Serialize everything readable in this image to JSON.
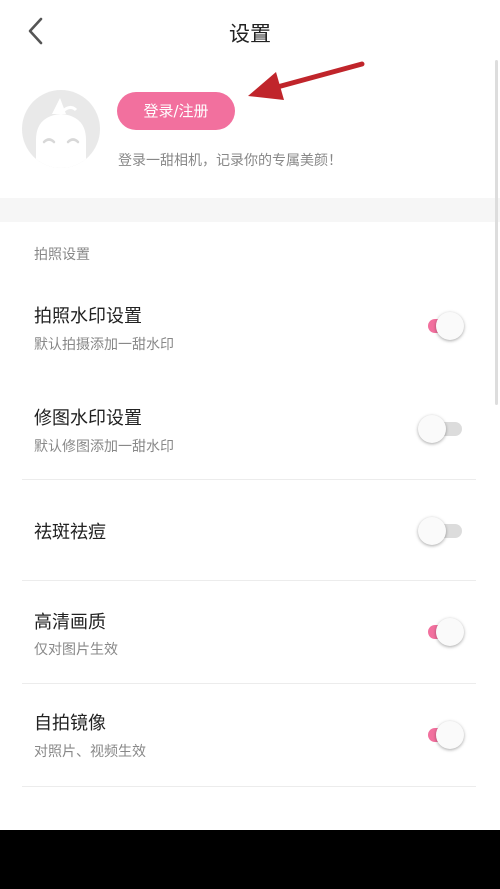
{
  "header": {
    "title": "设置",
    "back_icon": "chevron-left-icon"
  },
  "profile": {
    "avatar_icon": "unicorn-avatar-icon",
    "login_label": "登录/注册",
    "slogan": "登录一甜相机，记录你的专属美颜！",
    "annotation_arrow_color": "#c0252b"
  },
  "section": {
    "label": "拍照设置"
  },
  "settings": [
    {
      "title": "拍照水印设置",
      "subtitle": "默认拍摄添加一甜水印",
      "enabled": true
    },
    {
      "title": "修图水印设置",
      "subtitle": "默认修图添加一甜水印",
      "enabled": false
    },
    {
      "title": "祛斑祛痘",
      "subtitle": "",
      "enabled": false
    },
    {
      "title": "高清画质",
      "subtitle": "仅对图片生效",
      "enabled": true
    },
    {
      "title": "自拍镜像",
      "subtitle": "对照片、视频生效",
      "enabled": true
    }
  ],
  "colors": {
    "accent": "#f2709e",
    "toggle_off": "#dcdcdc"
  }
}
